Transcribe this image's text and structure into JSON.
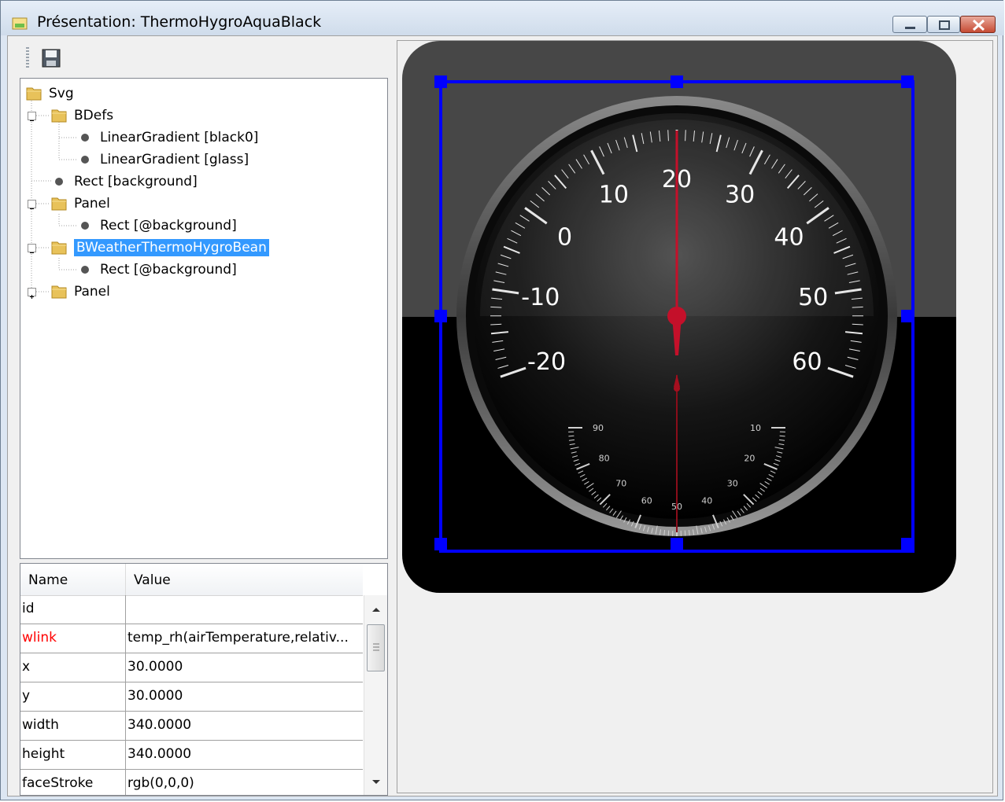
{
  "window": {
    "title": "Présentation: ThermoHygroAquaBlack",
    "buttons": [
      "minimize-icon",
      "maximize-icon",
      "close-icon"
    ]
  },
  "toolbar": {
    "save_icon": "save-icon"
  },
  "tree": {
    "items": [
      {
        "label": "Svg",
        "type": "folder"
      },
      {
        "label": "BDefs",
        "type": "folder",
        "expanded": true
      },
      {
        "label": "LinearGradient [black0]",
        "type": "leaf"
      },
      {
        "label": "LinearGradient [glass]",
        "type": "leaf"
      },
      {
        "label": "Rect [background]",
        "type": "leaf"
      },
      {
        "label": "Panel",
        "type": "folder",
        "expanded": true
      },
      {
        "label": "Rect [@background]",
        "type": "leaf"
      },
      {
        "label": "BWeatherThermoHygroBean",
        "type": "folder",
        "expanded": true,
        "selected": true
      },
      {
        "label": "Rect [@background]",
        "type": "leaf"
      },
      {
        "label": "Panel",
        "type": "folder",
        "expanded": false
      }
    ]
  },
  "properties": {
    "columns": [
      "Name",
      "Value"
    ],
    "rows": [
      {
        "name": "id",
        "value": ""
      },
      {
        "name": "wlink",
        "value": "temp_rh(airTemperature,relativ...",
        "highlight": true
      },
      {
        "name": "x",
        "value": "30.0000"
      },
      {
        "name": "y",
        "value": "30.0000"
      },
      {
        "name": "width",
        "value": "340.0000"
      },
      {
        "name": "height",
        "value": "340.0000"
      },
      {
        "name": "faceStroke",
        "value": "rgb(0,0,0)"
      }
    ]
  },
  "gauge": {
    "temperature_labels": [
      "-20",
      "-10",
      "0",
      "10",
      "20",
      "30",
      "40",
      "50",
      "60"
    ],
    "temperature_range": [
      -20,
      60
    ],
    "temperature_value": 20,
    "humidity_labels": [
      "90",
      "80",
      "70",
      "60",
      "50",
      "40",
      "30",
      "20",
      "10"
    ],
    "humidity_range": [
      90,
      10
    ],
    "humidity_value": 50
  },
  "colors": {
    "selection": "#3399ff",
    "selection_frame": "#0000ff",
    "needle": "#c4102a",
    "highlight_text": "#ff0000"
  }
}
